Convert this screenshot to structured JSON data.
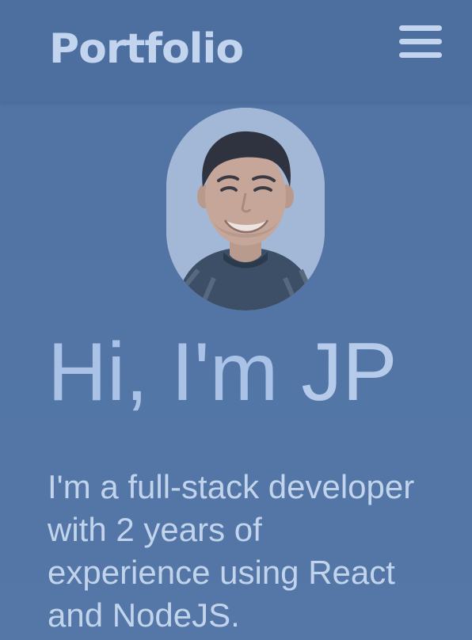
{
  "header": {
    "brand": "Portfolio",
    "menu_icon": "hamburger-menu-icon"
  },
  "hero": {
    "avatar_alt": "profile-photo",
    "greeting_prefix": "Hi, I'm ",
    "name": "JP",
    "intro": "I'm a full-stack developer with 2 years of experience using React and NodeJS."
  },
  "colors": {
    "background": "#5376a6",
    "header": "#4d6f9f",
    "text": "#c2d4ec",
    "title": "#a9c2e6"
  }
}
